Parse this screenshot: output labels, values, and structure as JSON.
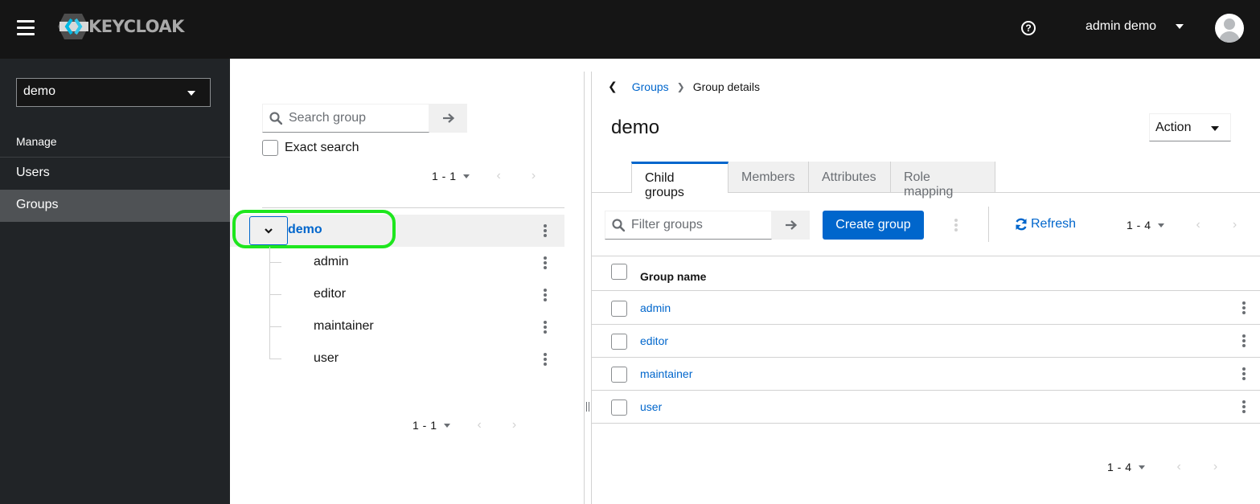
{
  "masthead": {
    "brand": "KEYCLOAK",
    "user_name": "admin demo",
    "icons": {
      "menu": "hamburger-icon",
      "help": "question-circle-icon",
      "avatar": "user-avatar-icon"
    }
  },
  "sidebar": {
    "realm": "demo",
    "section_title": "Manage",
    "items": [
      {
        "label": "Users",
        "active": false
      },
      {
        "label": "Groups",
        "active": true
      }
    ]
  },
  "tree_panel": {
    "search_placeholder": "Search group",
    "exact_search_label": "Exact search",
    "exact_search_checked": false,
    "pagination_top": "1 - 1",
    "pagination_bottom": "1 - 1",
    "root": {
      "label": "demo",
      "expanded": true
    },
    "children": [
      {
        "label": "admin"
      },
      {
        "label": "editor"
      },
      {
        "label": "maintainer"
      },
      {
        "label": "user"
      }
    ]
  },
  "details": {
    "breadcrumb": {
      "parent": "Groups",
      "current": "Group details"
    },
    "title": "demo",
    "action_label": "Action",
    "tabs": [
      {
        "label": "Child groups",
        "active": true
      },
      {
        "label": "Members",
        "active": false
      },
      {
        "label": "Attributes",
        "active": false
      },
      {
        "label": "Role mapping",
        "active": false
      }
    ],
    "filter_placeholder": "Filter groups",
    "create_label": "Create group",
    "refresh_label": "Refresh",
    "pagination_top": "1 - 4",
    "pagination_bottom": "1 - 4",
    "table": {
      "column": "Group name",
      "rows": [
        {
          "name": "admin"
        },
        {
          "name": "editor"
        },
        {
          "name": "maintainer"
        },
        {
          "name": "user"
        }
      ]
    }
  },
  "colors": {
    "masthead_bg": "#151515",
    "sidebar_bg": "#212427",
    "sidebar_active": "#4f5255",
    "link_blue": "#0066cc",
    "highlight_ring": "#1ee61e"
  }
}
